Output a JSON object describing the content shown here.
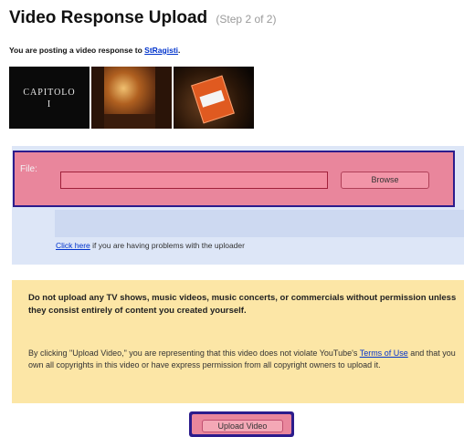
{
  "header": {
    "title": "Video Response Upload",
    "step": "(Step 2 of 2)"
  },
  "posting": {
    "text": "You are posting a video response to",
    "user_link": "StRagisti",
    "suffix": "."
  },
  "thumbnails": [
    {
      "name": "capitolo-thumbnail",
      "caption": "CAPITOLO\nI"
    },
    {
      "name": "room-thumbnail"
    },
    {
      "name": "orange-card-thumbnail"
    }
  ],
  "upload": {
    "file_label": "File:",
    "file_value": "",
    "browse_label": "Browse",
    "help_link": "Click here",
    "help_text": "if you are having problems with the uploader"
  },
  "warning": {
    "bold_text": "Do not upload any TV shows, music videos, music concerts, or commercials without permission unless they consist entirely of content you created yourself.",
    "text_before": "By clicking \"Upload Video,\" you are representing that this video does not violate YouTube's",
    "terms_link": "Terms of Use",
    "text_after": "and that you own all copyrights in this video or have express permission from all copyright owners to upload it."
  },
  "actions": {
    "upload_label": "Upload Video"
  },
  "colors": {
    "highlight_fill": "#e9869c",
    "highlight_border": "#2c1c8c",
    "upload_panel": "#dde6f7",
    "warning_panel": "#fce6a6",
    "link": "#0033cc"
  }
}
